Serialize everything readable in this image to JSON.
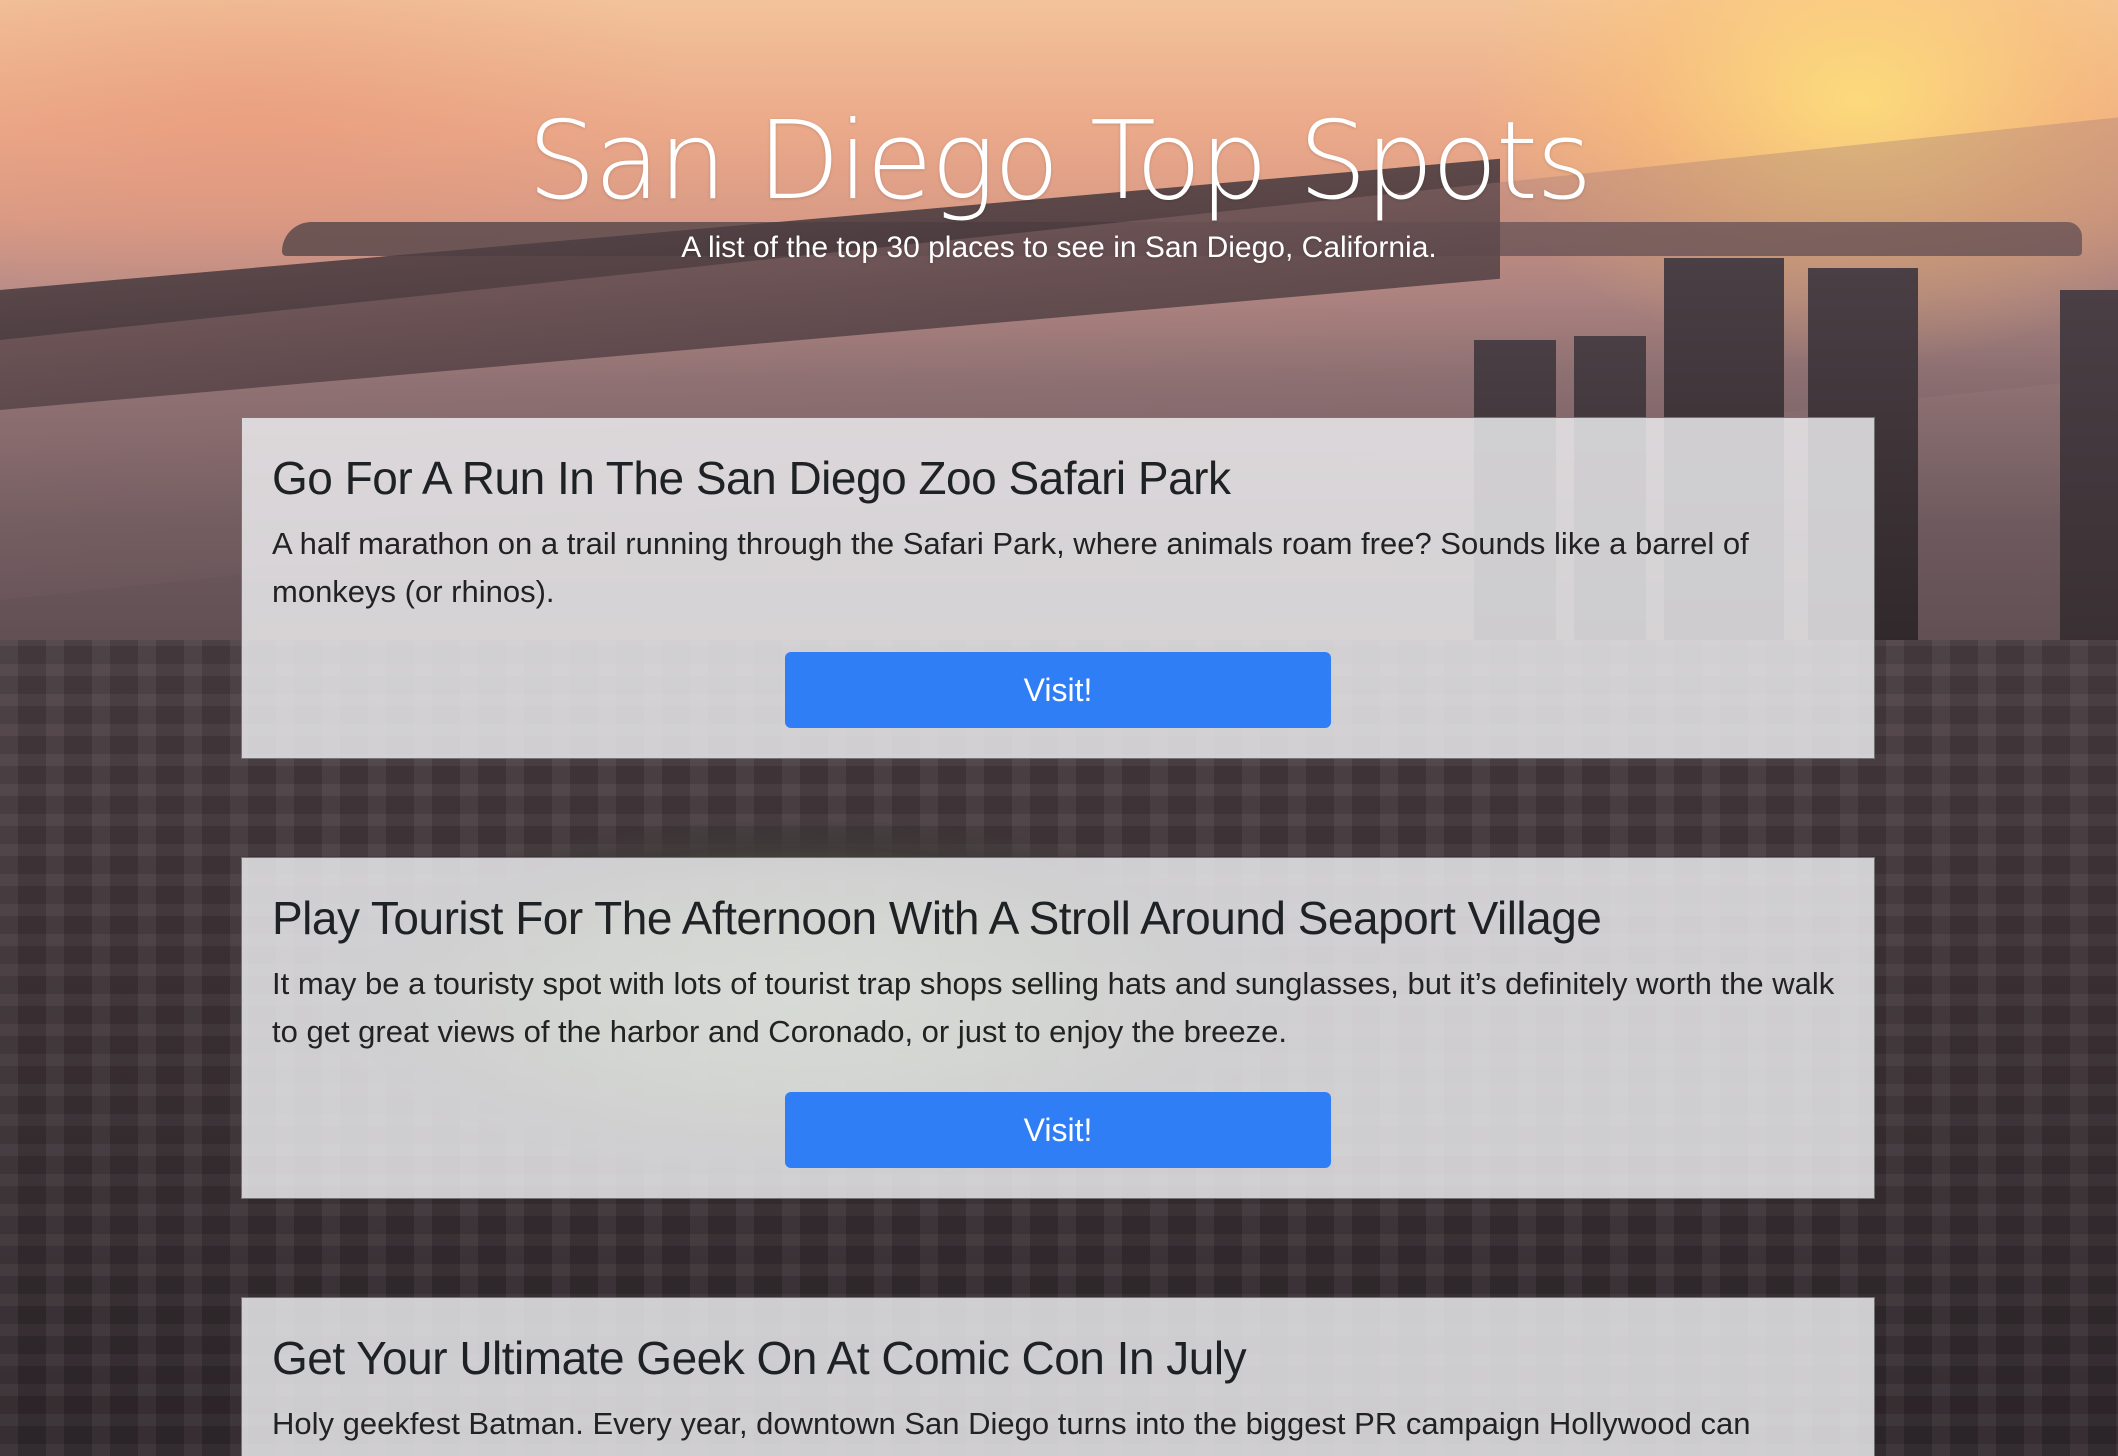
{
  "header": {
    "title": "San Diego Top Spots",
    "subtitle": "A list of the top 30 places to see in San Diego, California."
  },
  "spots": [
    {
      "title": "Go For A Run In The San Diego Zoo Safari Park",
      "description": "A half marathon on a trail running through the Safari Park, where animals roam free? Sounds like a barrel of monkeys (or rhinos).",
      "button_label": "Visit!"
    },
    {
      "title": "Play Tourist For The Afternoon With A Stroll Around Seaport Village",
      "description": "It may be a touristy spot with lots of tourist trap shops selling hats and sunglasses, but it’s definitely worth the walk to get great views of the harbor and Coronado, or just to enjoy the breeze.",
      "button_label": "Visit!"
    },
    {
      "title": "Get Your Ultimate Geek On At Comic Con In July",
      "description": "Holy geekfest Batman. Every year, downtown San Diego turns into the biggest PR campaign Hollywood can",
      "button_label": ""
    }
  ],
  "colors": {
    "button": "#2f7ef6",
    "card_background": "rgba(236,236,238,0.84)",
    "heading_text": "#1f2225"
  }
}
